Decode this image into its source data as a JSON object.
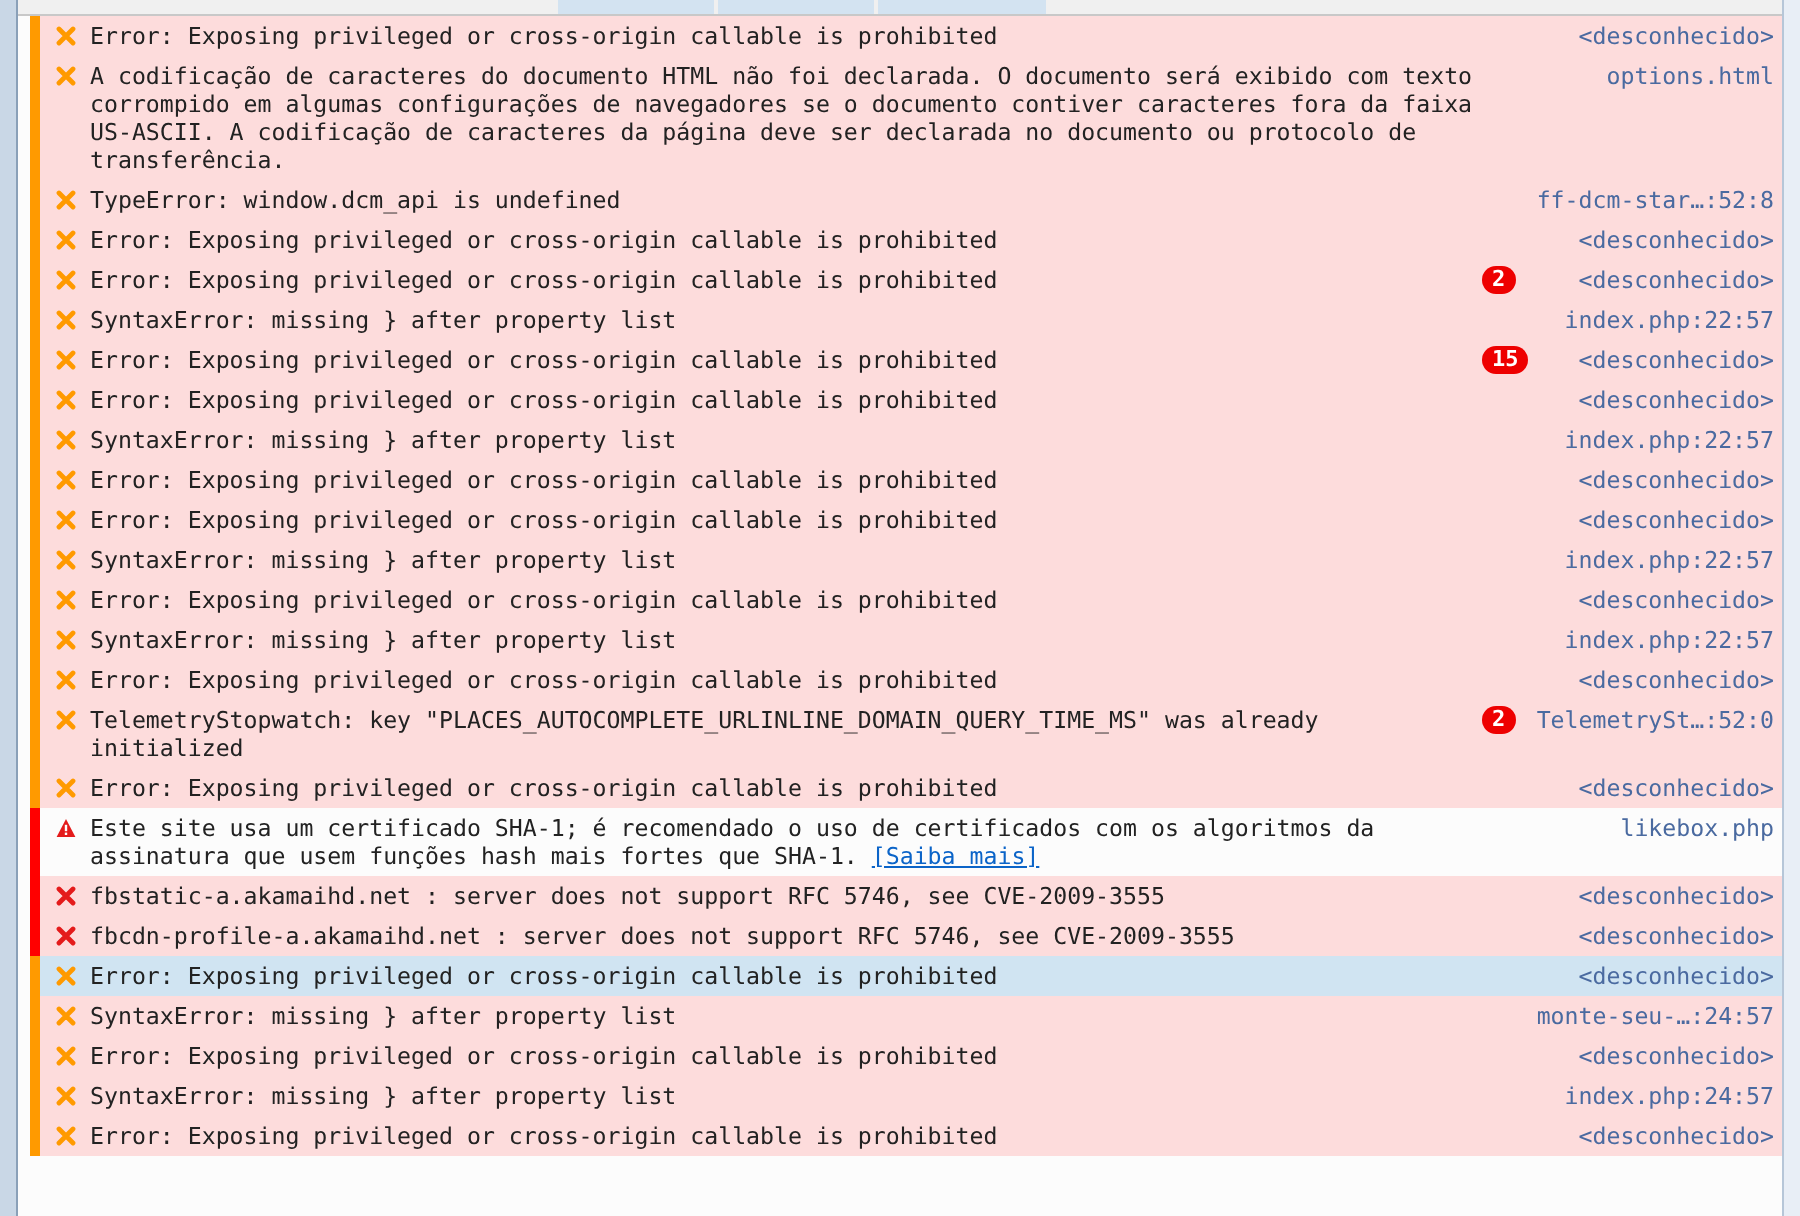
{
  "console": {
    "messages": [
      {
        "kind": "js",
        "text": "Error: Exposing privileged or cross-origin callable is prohibited",
        "source": "<desconhecido>",
        "selected": false
      },
      {
        "kind": "js",
        "text": "A codificação de caracteres do documento HTML não foi declarada. O documento será exibido com texto corrompido em algumas configurações de navegadores se o documento contiver caracteres fora da faixa US-ASCII. A codificação de caracteres da página deve ser declarada no documento ou protocolo de transferência.",
        "source": "options.html",
        "selected": false
      },
      {
        "kind": "js",
        "text": "TypeError: window.dcm_api is undefined",
        "source": "ff-dcm-star…:52:8",
        "selected": false
      },
      {
        "kind": "js",
        "text": "Error: Exposing privileged or cross-origin callable is prohibited",
        "source": "<desconhecido>",
        "selected": false
      },
      {
        "kind": "js",
        "text": "Error: Exposing privileged or cross-origin callable is prohibited",
        "count": "2",
        "source": "<desconhecido>",
        "selected": false
      },
      {
        "kind": "js",
        "text": "SyntaxError: missing } after property list",
        "source": "index.php:22:57",
        "selected": false
      },
      {
        "kind": "js",
        "text": "Error: Exposing privileged or cross-origin callable is prohibited",
        "count": "15",
        "source": "<desconhecido>",
        "selected": false
      },
      {
        "kind": "js",
        "text": "Error: Exposing privileged or cross-origin callable is prohibited",
        "source": "<desconhecido>",
        "selected": false
      },
      {
        "kind": "js",
        "text": "SyntaxError: missing } after property list",
        "source": "index.php:22:57",
        "selected": false
      },
      {
        "kind": "js",
        "text": "Error: Exposing privileged or cross-origin callable is prohibited",
        "source": "<desconhecido>",
        "selected": false
      },
      {
        "kind": "js",
        "text": "Error: Exposing privileged or cross-origin callable is prohibited",
        "source": "<desconhecido>",
        "selected": false
      },
      {
        "kind": "js",
        "text": "SyntaxError: missing } after property list",
        "source": "index.php:22:57",
        "selected": false
      },
      {
        "kind": "js",
        "text": "Error: Exposing privileged or cross-origin callable is prohibited",
        "source": "<desconhecido>",
        "selected": false
      },
      {
        "kind": "js",
        "text": "SyntaxError: missing } after property list",
        "source": "index.php:22:57",
        "selected": false
      },
      {
        "kind": "js",
        "text": "Error: Exposing privileged or cross-origin callable is prohibited",
        "source": "<desconhecido>",
        "selected": false
      },
      {
        "kind": "js",
        "text": "TelemetryStopwatch: key \"PLACES_AUTOCOMPLETE_URLINLINE_DOMAIN_QUERY_TIME_MS\" was already initialized",
        "count": "2",
        "source": "TelemetrySt…:52:0",
        "selected": false
      },
      {
        "kind": "js",
        "text": "Error: Exposing privileged or cross-origin callable is prohibited",
        "source": "<desconhecido>",
        "selected": false
      },
      {
        "kind": "security-warning",
        "text": "Este site usa um certificado SHA-1; é recomendado o uso de certificados com os algoritmos da assinatura que usem funções hash mais fortes que SHA-1.",
        "link": "[Saiba mais]",
        "source": "likebox.php",
        "selected": false
      },
      {
        "kind": "security-error",
        "text": "fbstatic-a.akamaihd.net : server does not support RFC 5746, see CVE-2009-3555",
        "source": "<desconhecido>",
        "selected": false
      },
      {
        "kind": "security-error",
        "text": "fbcdn-profile-a.akamaihd.net : server does not support RFC 5746, see CVE-2009-3555",
        "source": "<desconhecido>",
        "selected": false
      },
      {
        "kind": "js",
        "text": "Error: Exposing privileged or cross-origin callable is prohibited",
        "source": "<desconhecido>",
        "selected": true
      },
      {
        "kind": "js",
        "text": "SyntaxError: missing } after property list",
        "source": "monte-seu-…:24:57",
        "selected": false
      },
      {
        "kind": "js",
        "text": "Error: Exposing privileged or cross-origin callable is prohibited",
        "source": "<desconhecido>",
        "selected": false
      },
      {
        "kind": "js",
        "text": "SyntaxError: missing } after property list",
        "source": "index.php:24:57",
        "selected": false
      },
      {
        "kind": "js",
        "text": "Error: Exposing privileged or cross-origin callable is prohibited",
        "source": "<desconhecido>",
        "selected": false
      }
    ]
  }
}
